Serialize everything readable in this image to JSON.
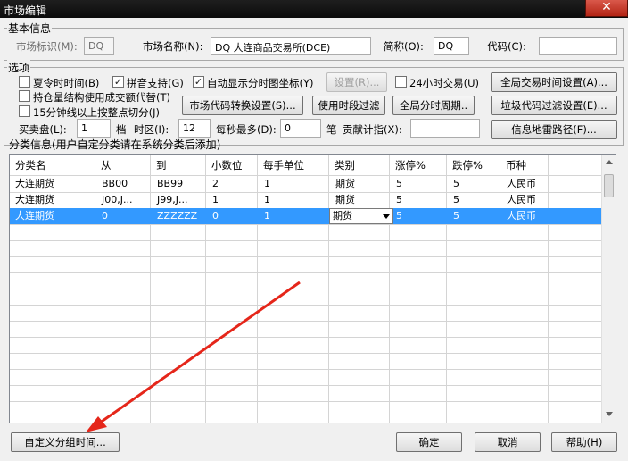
{
  "window": {
    "title": "市场编辑",
    "close_glyph": "✕"
  },
  "basic": {
    "group_label": "基本信息",
    "market_id_label": "市场标识(M):",
    "market_id_value": "DQ",
    "market_name_label": "市场名称(N):",
    "market_name_value": "DQ 大连商品交易所(DCE)",
    "short_label": "简称(O):",
    "short_value": "DQ",
    "code_label": "代码(C):",
    "code_value": ""
  },
  "options": {
    "group_label": "选项",
    "summer_time": {
      "label": "夏令时时间(B)",
      "checked": false
    },
    "pinyin": {
      "label": "拼音支持(G)",
      "checked": true
    },
    "auto_coords": {
      "label": "自动显示分时图坐标(Y)",
      "checked": true
    },
    "settings_btn": "设置(R)...",
    "h24": {
      "label": "24小时交易(U)",
      "checked": false
    },
    "global_time_btn": "全局交易时间设置(A)...",
    "position_struct": {
      "label": "持仓量结构使用成交额代替(T)",
      "checked": false
    },
    "m15_split": {
      "label": "15分钟线以上按整点切分(J)",
      "checked": false
    },
    "code_convert_btn": "市场代码转换设置(S)...",
    "time_filter_btn": "使用时段过滤",
    "global_period_btn": "全局分时周期..",
    "junk_filter_btn": "垃圾代码过滤设置(E)...",
    "depth_label": "买卖盘(L):",
    "depth_value": "1",
    "depth_unit": "档",
    "tz_label": "时区(I):",
    "tz_value": "12",
    "max_per_sec_label": "每秒最多(D):",
    "max_per_sec_value": "0",
    "max_per_sec_unit": "笔",
    "contrib_label": "贡献计指(X):",
    "contrib_value": "",
    "mine_path_btn": "信息地雷路径(F)..."
  },
  "category": {
    "group_label": "分类信息(用户自定分类请在系统分类后添加)",
    "headers": [
      "分类名",
      "从",
      "到",
      "小数位",
      "每手单位",
      "类别",
      "涨停%",
      "跌停%",
      "币种"
    ],
    "rows": [
      [
        "大连期货",
        "BB00",
        "BB99",
        "2",
        "1",
        "期货",
        "5",
        "5",
        "人民币"
      ],
      [
        "大连期货",
        "J00,J...",
        "J99,J...",
        "1",
        "1",
        "期货",
        "5",
        "5",
        "人民币"
      ],
      [
        "大连期货",
        "0",
        "ZZZZZZ",
        "0",
        "1",
        "期货",
        "5",
        "5",
        "人民币"
      ]
    ],
    "selected_row": 2
  },
  "footer": {
    "custom_group_btn": "自定义分组时间...",
    "ok_btn": "确定",
    "cancel_btn": "取消",
    "help_btn": "帮助(H)"
  },
  "colors": {
    "selection": "#3399ff",
    "arrow": "#e5261a"
  }
}
